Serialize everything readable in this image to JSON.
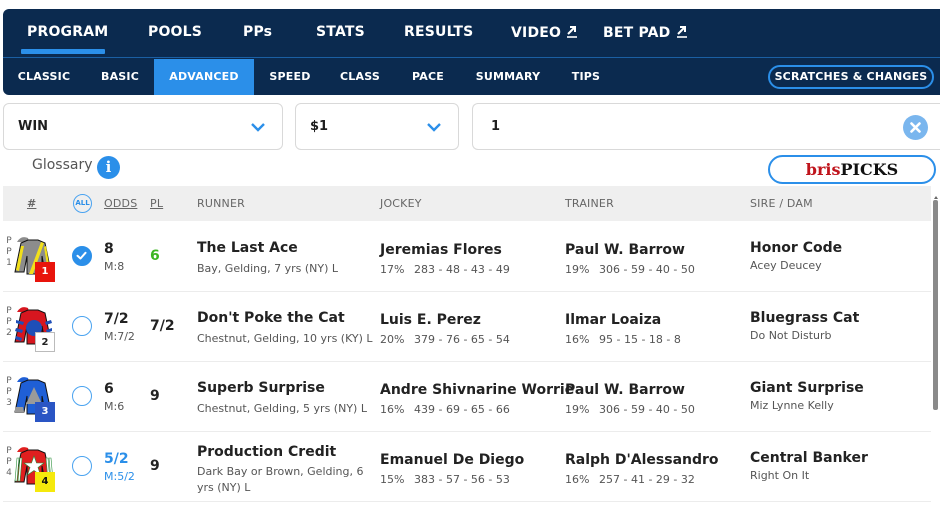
{
  "nav": {
    "primary": [
      {
        "label": "PROGRAM",
        "active": true
      },
      {
        "label": "POOLS"
      },
      {
        "label": "PPs"
      },
      {
        "label": "STATS"
      },
      {
        "label": "RESULTS"
      },
      {
        "label": "VIDEO",
        "icon": "external-link-icon"
      },
      {
        "label": "BET PAD",
        "icon": "external-link-icon"
      }
    ],
    "secondary": [
      {
        "label": "CLASSIC"
      },
      {
        "label": "BASIC"
      },
      {
        "label": "ADVANCED",
        "active": true
      },
      {
        "label": "SPEED"
      },
      {
        "label": "CLASS"
      },
      {
        "label": "PACE"
      },
      {
        "label": "SUMMARY"
      },
      {
        "label": "TIPS"
      }
    ],
    "scratches_label": "SCRATCHES & CHANGES"
  },
  "bet": {
    "type": "WIN",
    "amount": "$1",
    "selection": "1"
  },
  "glossary_label": "Glossary",
  "info_icon": "i",
  "brispicks": {
    "bris": "bris",
    "picks": "PICKS"
  },
  "table": {
    "headers": {
      "num": "#",
      "all": "ALL",
      "odds": "ODDS",
      "pl": "PL",
      "runner": "RUNNER",
      "jockey": "JOCKEY",
      "trainer": "TRAINER",
      "sire_dam": "SIRE / DAM"
    },
    "pp_label": "P\nP",
    "rows": [
      {
        "pp": "1",
        "program": "1",
        "selected": true,
        "odds": "8",
        "ml": "M:8",
        "pl": "6",
        "runner": "The Last Ace",
        "desc": "Bay, Gelding, 7 yrs (NY) L",
        "jockey": "Jeremias Flores",
        "jockey_pct": "17%",
        "jockey_stats": "283 - 48 - 43 - 49",
        "trainer": "Paul W. Barrow",
        "trainer_pct": "19%",
        "trainer_stats": "306 - 59 - 40 - 50",
        "sire": "Honor Code",
        "dam": "Acey Deucey",
        "colors": {
          "saddle": "#e8140c",
          "saddle_text": "#ffffff",
          "silk_body": "#8c8c8c",
          "silk_accent": "#f2e01a"
        }
      },
      {
        "pp": "2",
        "program": "2",
        "selected": false,
        "odds": "7/2",
        "ml": "M:7/2",
        "pl": "7/2",
        "runner": "Don't Poke the Cat",
        "desc": "Chestnut, Gelding, 10 yrs (KY) L",
        "jockey": "Luis E. Perez",
        "jockey_pct": "20%",
        "jockey_stats": "379 - 76 - 65 - 54",
        "trainer": "Ilmar Loaiza",
        "trainer_pct": "16%",
        "trainer_stats": "95 - 15 - 18 - 8",
        "sire": "Bluegrass Cat",
        "dam": "Do Not Disturb",
        "colors": {
          "saddle": "#ffffff",
          "saddle_text": "#222222",
          "silk_body": "#d7161f",
          "silk_accent": "#1f4fb8"
        }
      },
      {
        "pp": "3",
        "program": "3",
        "selected": false,
        "odds": "6",
        "ml": "M:6",
        "pl": "9",
        "runner": "Superb Surprise",
        "desc": "Chestnut, Gelding, 5 yrs (NY) L",
        "jockey": "Andre Shivnarine Worrie",
        "jockey_pct": "16%",
        "jockey_stats": "439 - 69 - 65 - 66",
        "trainer": "Paul W. Barrow",
        "trainer_pct": "19%",
        "trainer_stats": "306 - 59 - 40 - 50",
        "sire": "Giant Surprise",
        "dam": "Miz Lynne Kelly",
        "colors": {
          "saddle": "#2a55c4",
          "saddle_text": "#ffffff",
          "silk_body": "#1f5fd6",
          "silk_accent": "#9a9a9a"
        }
      },
      {
        "pp": "4",
        "program": "4",
        "selected": false,
        "odds": "5/2",
        "ml": "M:5/2",
        "pl": "9",
        "runner": "Production Credit",
        "desc": "Dark Bay or Brown, Gelding, 6 yrs (NY) L",
        "jockey": "Emanuel De Diego",
        "jockey_pct": "15%",
        "jockey_stats": "383 - 57 - 56 - 53",
        "trainer": "Ralph D'Alessandro",
        "trainer_pct": "16%",
        "trainer_stats": "257 - 41 - 29 - 32",
        "sire": "Central Banker",
        "dam": "Right On It",
        "colors": {
          "saddle": "#f5e90c",
          "saddle_text": "#111111",
          "silk_body": "#e01f1f",
          "silk_accent": "#2a8f3a"
        }
      }
    ]
  },
  "colors": {
    "nav_bg": "#0b2a4f",
    "accent": "#2b8fe9",
    "pl_green": "#3cb521",
    "favorite_blue": "#2b8fe9"
  }
}
